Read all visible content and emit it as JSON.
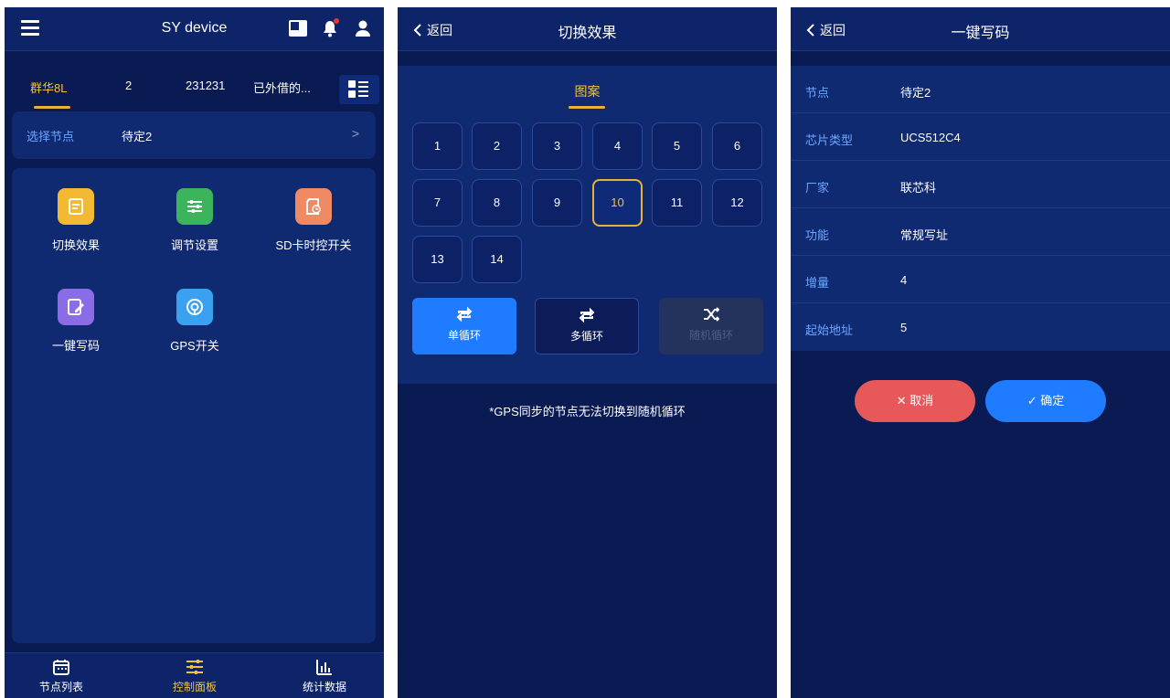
{
  "screen1": {
    "title": "SY device",
    "tabs": [
      "群华8L",
      "2",
      "231231",
      "已外借的..."
    ],
    "node_label": "选择节点",
    "node_value": "待定2",
    "functions": [
      "切换效果",
      "调节设置",
      "SD卡时控开关",
      "一键写码",
      "GPS开关"
    ],
    "bottom_nav": [
      "节点列表",
      "控制面板",
      "统计数据"
    ]
  },
  "screen2": {
    "back": "返回",
    "title": "切换效果",
    "tab": "图案",
    "patterns": [
      "1",
      "2",
      "3",
      "4",
      "5",
      "6",
      "7",
      "8",
      "9",
      "10",
      "11",
      "12",
      "13",
      "14"
    ],
    "selected_pattern": "10",
    "modes": [
      "单循环",
      "多循环",
      "随机循环"
    ],
    "note": "*GPS同步的节点无法切换到随机循环"
  },
  "screen3": {
    "back": "返回",
    "title": "一键写码",
    "rows": [
      {
        "k": "节点",
        "v": "待定2"
      },
      {
        "k": "芯片类型",
        "v": "UCS512C4"
      },
      {
        "k": "厂家",
        "v": "联芯科"
      },
      {
        "k": "功能",
        "v": "常规写址"
      },
      {
        "k": "增量",
        "v": "4"
      },
      {
        "k": "起始地址",
        "v": "5"
      }
    ],
    "cancel": "取消",
    "confirm": "确定"
  },
  "colors": {
    "bg": "#0a1a52",
    "panel": "#102a72",
    "accent_gold": "#f0c23c",
    "accent_blue": "#1f7bff",
    "cancel_red": "#e6585a"
  }
}
